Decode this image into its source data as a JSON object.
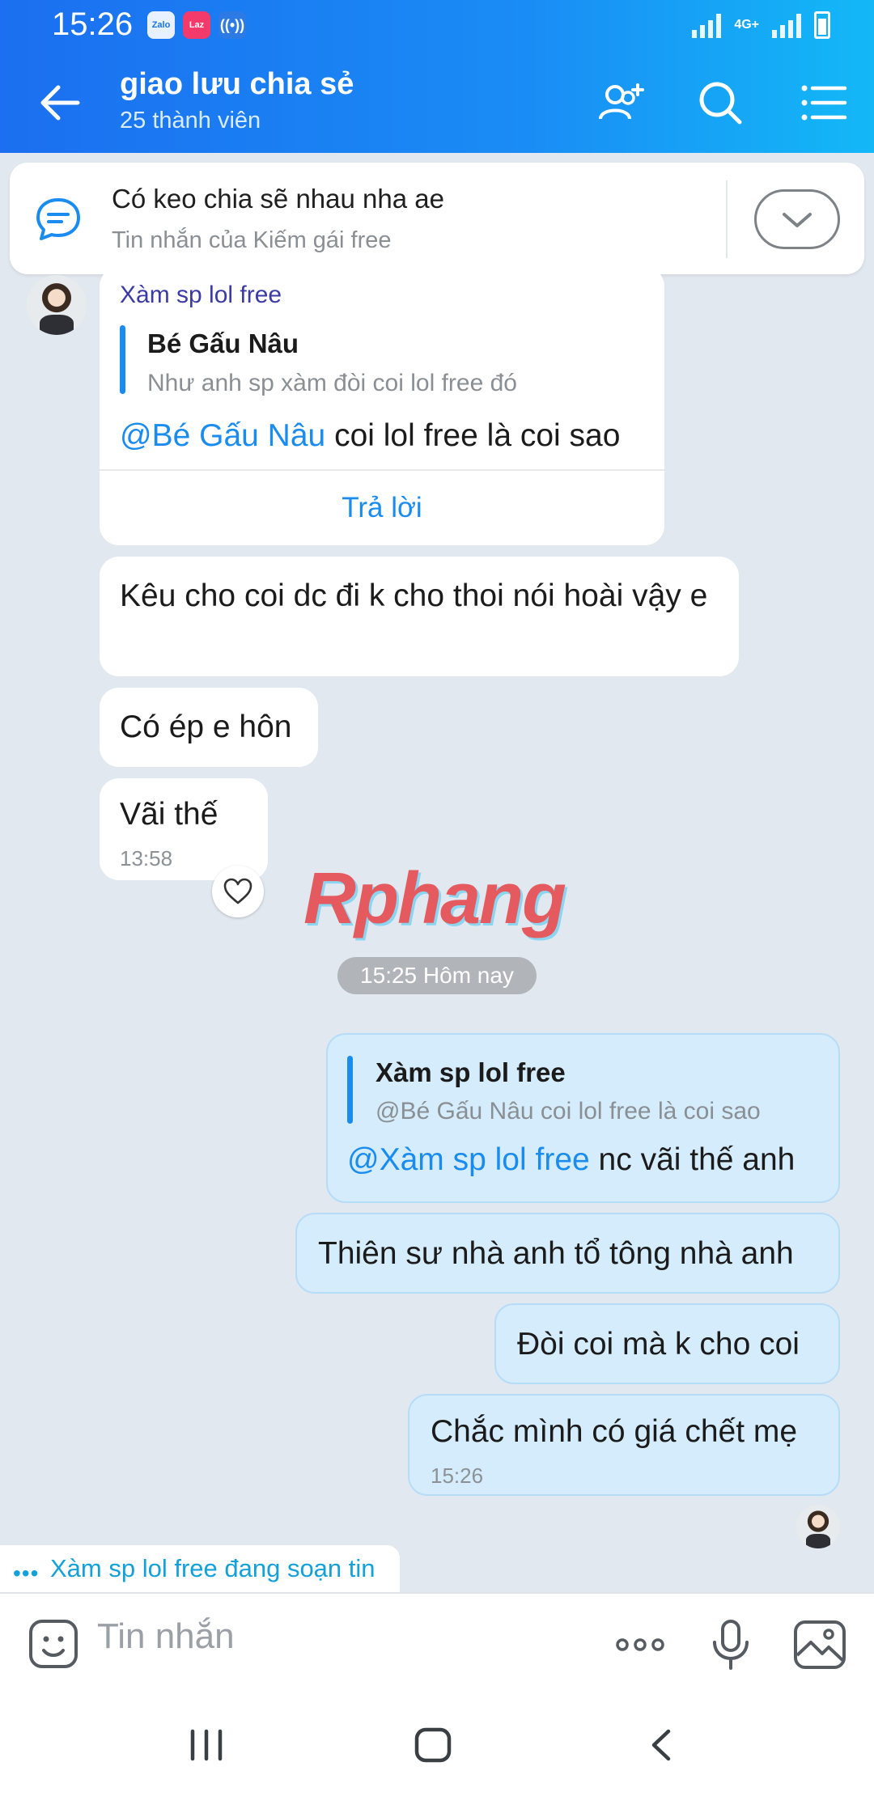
{
  "status_bar": {
    "time": "15:26",
    "app_icons": [
      "Zalo",
      "Laz",
      "wifi-hotspot"
    ],
    "network": "4G+"
  },
  "header": {
    "title": "giao lưu chia sẻ",
    "subtitle": "25 thành viên",
    "icons": [
      "back-arrow-icon",
      "add-member-icon",
      "search-icon",
      "menu-list-icon"
    ]
  },
  "pinned": {
    "title": "Có keo chia sẽ nhau nha ae",
    "subtitle": "Tin nhắn của Kiếm gái free"
  },
  "messages": {
    "m1": {
      "sender": "Xàm sp lol free",
      "quote_name": "Bé Gấu Nâu",
      "quote_text": "Như anh sp xàm đòi coi lol free đó",
      "mention": "@Bé Gấu Nâu",
      "text": " coi lol free là coi sao",
      "reply_label": "Trả lời"
    },
    "m2": {
      "text": "Kêu cho coi dc đi k cho thoi nói hoài vậy e"
    },
    "m3": {
      "text": "Có ép e hôn"
    },
    "m4": {
      "text": "Vãi thế",
      "time": "13:58"
    },
    "day_separator": "15:25 Hôm nay",
    "m5": {
      "quote_name": "Xàm sp lol free",
      "quote_text": "@Bé Gấu Nâu coi lol free là coi sao",
      "mention": "@Xàm sp lol free",
      "text": " nc vãi thế anh"
    },
    "m6": {
      "text": "Thiên sư nhà anh tổ tông nhà anh"
    },
    "m7": {
      "text": "Đòi coi mà k cho coi"
    },
    "m8": {
      "text": "Chắc mình có giá chết mẹ",
      "time": "15:26"
    }
  },
  "watermark": "Rphang",
  "typing_indicator": {
    "dots": "•••",
    "text": "Xàm sp lol free đang soạn tin"
  },
  "input": {
    "placeholder": "Tin nhắn"
  },
  "colors": {
    "header_start": "#1b6ff0",
    "header_end": "#13b8f7",
    "accent": "#1a8cf0",
    "outgoing_bubble": "#d4ecfc",
    "chat_background": "#e2e8ef"
  }
}
